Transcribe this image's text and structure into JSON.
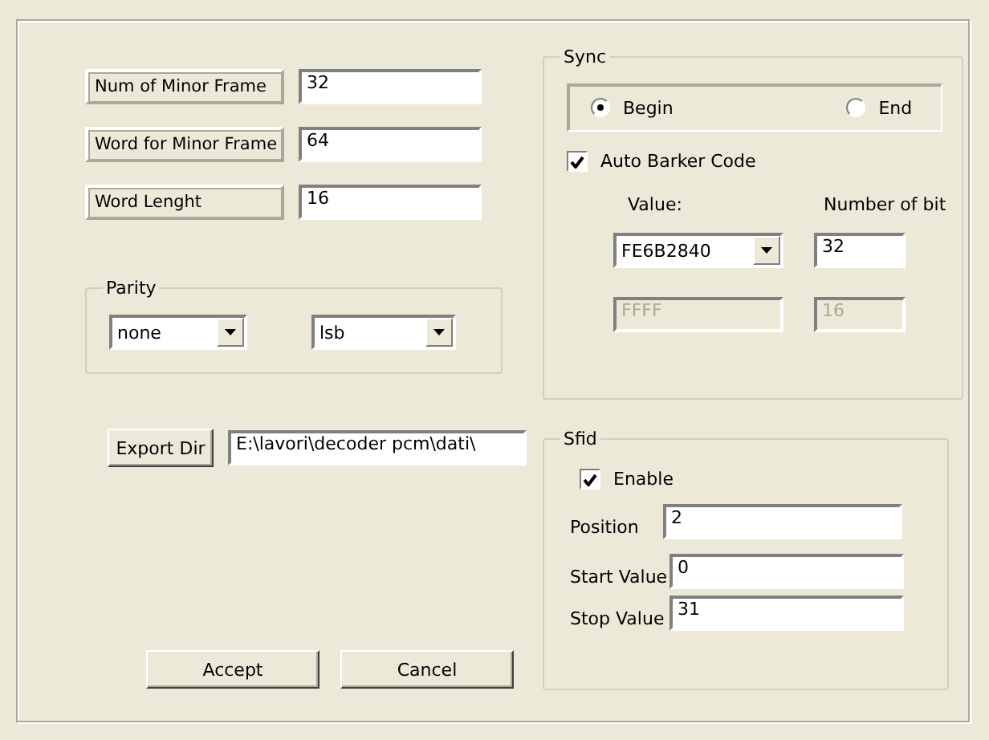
{
  "frame_fields": [
    {
      "label": "Num of Minor Frame",
      "value": "32"
    },
    {
      "label": "Word for Minor Frame",
      "value": "64"
    },
    {
      "label": "Word Lenght",
      "value": "16"
    }
  ],
  "parity": {
    "title": "Parity",
    "selects": [
      {
        "value": "none"
      },
      {
        "value": "lsb"
      }
    ]
  },
  "export": {
    "button": "Export Dir",
    "value": "E:\\lavori\\decoder pcm\\dati\\"
  },
  "buttons": [
    {
      "label": "Accept"
    },
    {
      "label": "Cancel"
    }
  ],
  "sync": {
    "title": "Sync",
    "position": [
      {
        "label": "Begin",
        "selected": true
      },
      {
        "label": "End",
        "selected": false
      }
    ],
    "auto_barker": {
      "label": "Auto Barker Code",
      "checked": true
    },
    "value_heading": "Value:",
    "bits_heading": "Number of bit",
    "rows": [
      {
        "value": "FE6B2840",
        "bits": "32",
        "kind": "select",
        "disabled": false
      },
      {
        "value": "FFFF",
        "bits": "16",
        "kind": "text",
        "disabled": true
      }
    ]
  },
  "sfid": {
    "title": "Sfid",
    "enable": {
      "label": "Enable",
      "checked": true
    },
    "fields": [
      {
        "label": "Position",
        "value": "2"
      },
      {
        "label": "Start Value",
        "value": "0"
      },
      {
        "label": "Stop Value",
        "value": "31"
      }
    ]
  }
}
